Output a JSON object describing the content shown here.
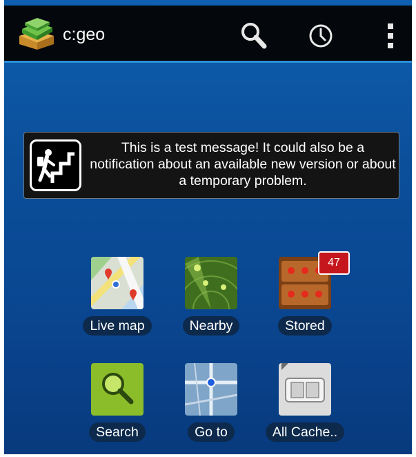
{
  "actionbar": {
    "title": "c:geo",
    "icons": [
      "app-logo-icon",
      "search-icon",
      "history-icon",
      "overflow-menu-icon"
    ]
  },
  "message": {
    "text": "This is a test message! It could also be a notification about an available new version or about a temporary problem.",
    "icon": "hiker-icon"
  },
  "grid": {
    "items": [
      {
        "label": "Live map",
        "icon": "live-map-icon"
      },
      {
        "label": "Nearby",
        "icon": "nearby-radar-icon"
      },
      {
        "label": "Stored",
        "icon": "stored-icon",
        "badge": "47"
      },
      {
        "label": "Search",
        "icon": "search-magnifier-icon"
      },
      {
        "label": "Go to",
        "icon": "goto-icon"
      },
      {
        "label": "All Cache..",
        "icon": "all-caches-icon"
      }
    ]
  },
  "colors": {
    "actionbar_bg": "#04080c",
    "accent_line": "#2b8fd8",
    "background_top": "#0f5fb0",
    "background_bottom": "#083a7d",
    "badge": "#c4161c"
  }
}
